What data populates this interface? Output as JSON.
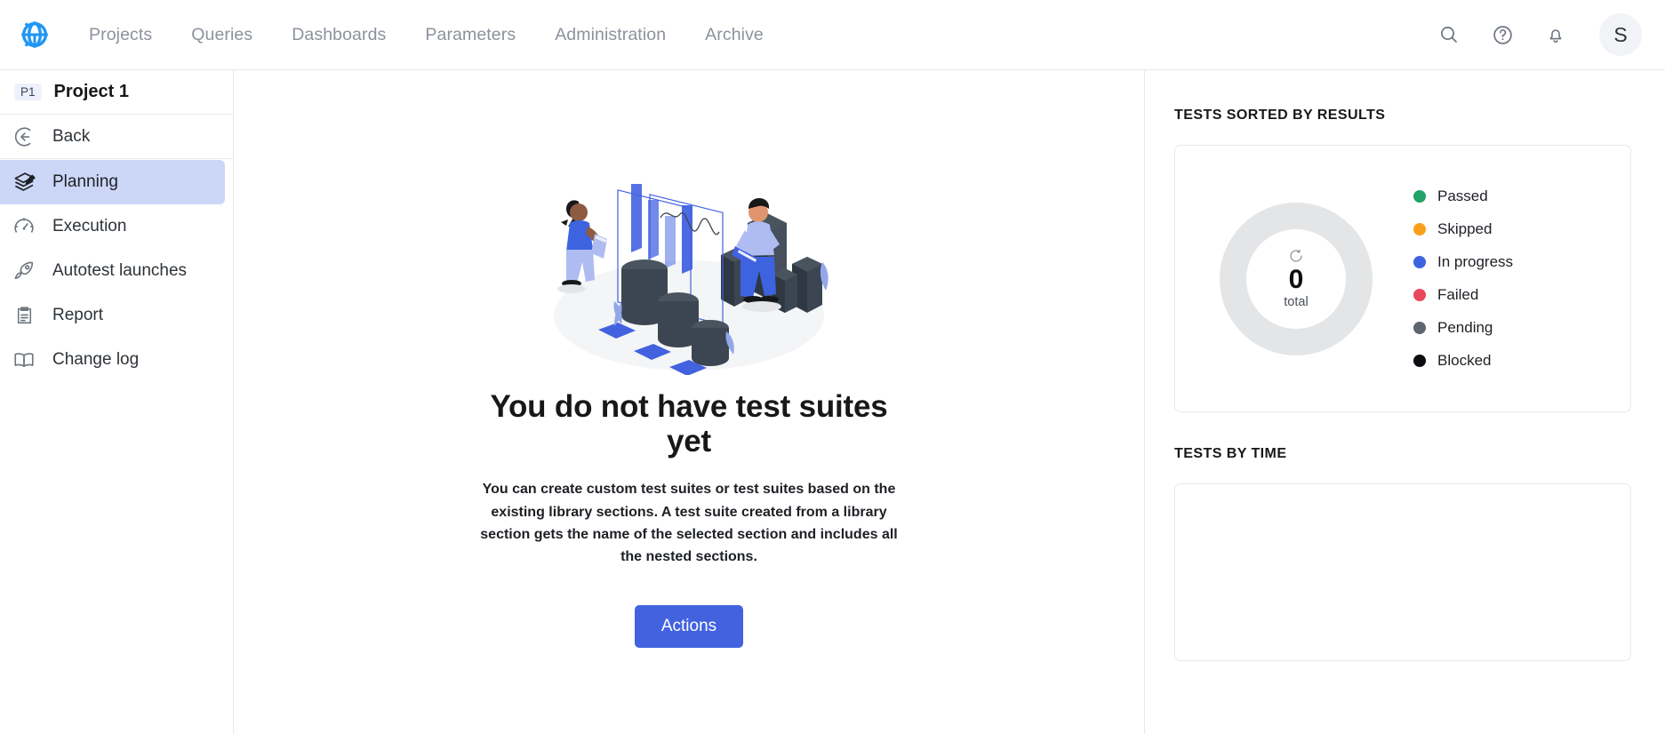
{
  "app": {
    "logo_icon": "sphere-gear-logo",
    "accent_color": "#4262e0",
    "logo_color": "#2196f3"
  },
  "topnav": {
    "items": [
      {
        "label": "Projects",
        "name": "projects"
      },
      {
        "label": "Queries",
        "name": "queries"
      },
      {
        "label": "Dashboards",
        "name": "dashboards"
      },
      {
        "label": "Parameters",
        "name": "parameters"
      },
      {
        "label": "Administration",
        "name": "administration"
      },
      {
        "label": "Archive",
        "name": "archive"
      }
    ],
    "actions": {
      "search_icon": "search-icon",
      "help_icon": "help-circle-icon",
      "notifications_icon": "bell-icon",
      "avatar_initial": "S"
    }
  },
  "sidebar": {
    "project_badge": "P1",
    "project_name": "Project 1",
    "items": [
      {
        "label": "Back",
        "icon": "arrow-left-circle-icon",
        "active": false
      },
      {
        "label": "Planning",
        "icon": "layers-pen-icon",
        "active": true
      },
      {
        "label": "Execution",
        "icon": "gauge-icon",
        "active": false
      },
      {
        "label": "Autotest launches",
        "icon": "rocket-icon",
        "active": false
      },
      {
        "label": "Report",
        "icon": "clipboard-icon",
        "active": false
      },
      {
        "label": "Change log",
        "icon": "book-icon",
        "active": false
      }
    ]
  },
  "main": {
    "illustration": "isometric-analytics-people-charts",
    "title": "You do not have test suites yet",
    "description": "You can create custom test suites or test suites based on the existing library sections. A test suite created from a library section gets the name of the selected section and includes all the nested sections.",
    "action_button": "Actions"
  },
  "right_panel": {
    "results_title": "TESTS SORTED BY RESULTS",
    "time_title": "TESTS BY TIME",
    "donut": {
      "value": "0",
      "caption": "total",
      "refresh_icon": "refresh-icon",
      "track_color": "#e4e5e7"
    },
    "legend": [
      {
        "label": "Passed",
        "color": "#21a366"
      },
      {
        "label": "Skipped",
        "color": "#f9a01b"
      },
      {
        "label": "In progress",
        "color": "#3d63e0"
      },
      {
        "label": "Failed",
        "color": "#e8485b"
      },
      {
        "label": "Pending",
        "color": "#5f6670"
      },
      {
        "label": "Blocked",
        "color": "#0b0d11"
      }
    ]
  },
  "chart_data": {
    "type": "pie",
    "title": "TESTS SORTED BY RESULTS",
    "categories": [
      "Passed",
      "Skipped",
      "In progress",
      "Failed",
      "Pending",
      "Blocked"
    ],
    "values": [
      0,
      0,
      0,
      0,
      0,
      0
    ],
    "total": 0,
    "center_label": "0 total",
    "colors": [
      "#21a366",
      "#f9a01b",
      "#3d63e0",
      "#e8485b",
      "#5f6670",
      "#0b0d11"
    ],
    "legend_position": "right",
    "empty": true,
    "empty_track_color": "#e4e5e7"
  }
}
